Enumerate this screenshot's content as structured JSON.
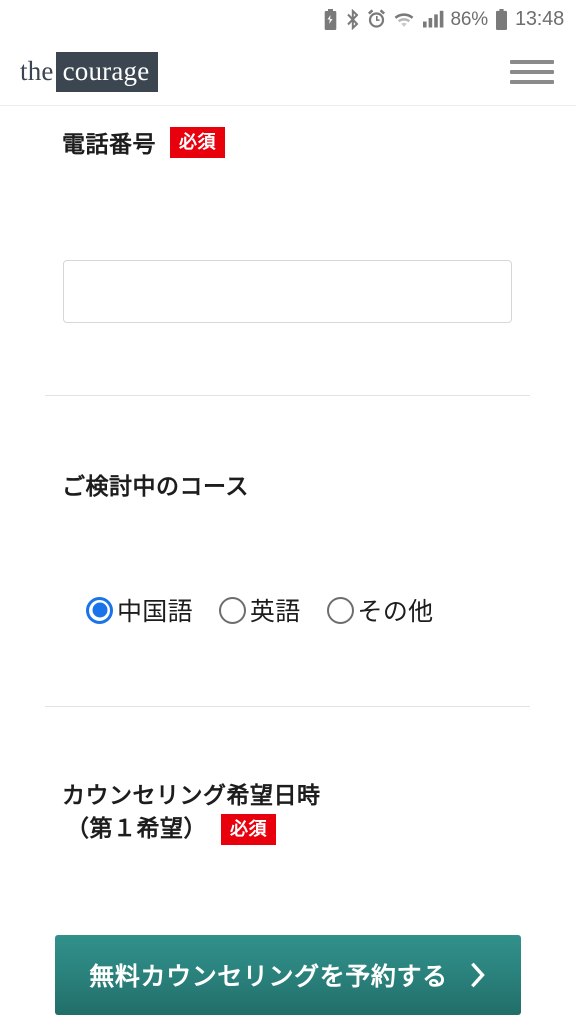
{
  "status_bar": {
    "icons": [
      {
        "name": "battery-saver-icon",
        "glyph": "battery-saver"
      },
      {
        "name": "bluetooth-icon",
        "glyph": "bluetooth"
      },
      {
        "name": "alarm-clock-icon",
        "glyph": "alarm"
      },
      {
        "name": "wifi-icon",
        "glyph": "wifi"
      },
      {
        "name": "cellular-signal-icon",
        "glyph": "signal"
      }
    ],
    "battery_percent": "86%",
    "time": "13:48"
  },
  "header": {
    "logo_prefix": "the",
    "logo_mark": "courage",
    "menu_label": "menu",
    "logo_box_color": "#3b4650"
  },
  "form": {
    "phone": {
      "label": "電話番号",
      "required_badge": "必須",
      "value": "",
      "placeholder": ""
    },
    "course": {
      "label": "ご検討中のコース",
      "options": [
        {
          "label": "中国語",
          "checked": true
        },
        {
          "label": "英語",
          "checked": false
        },
        {
          "label": "その他",
          "checked": false
        }
      ]
    },
    "counseling_datetime": {
      "label_line1": "カウンセリング希望日時",
      "label_line2": "（第１希望）",
      "required_badge": "必須"
    }
  },
  "cta": {
    "label": "無料カウンセリングを予約する",
    "chevron": "❯",
    "color_top": "#31908a",
    "color_bottom": "#226e69"
  },
  "colors": {
    "required_red": "#e8000d",
    "radio_blue": "#1a73e8",
    "divider": "#e3e3e3"
  }
}
